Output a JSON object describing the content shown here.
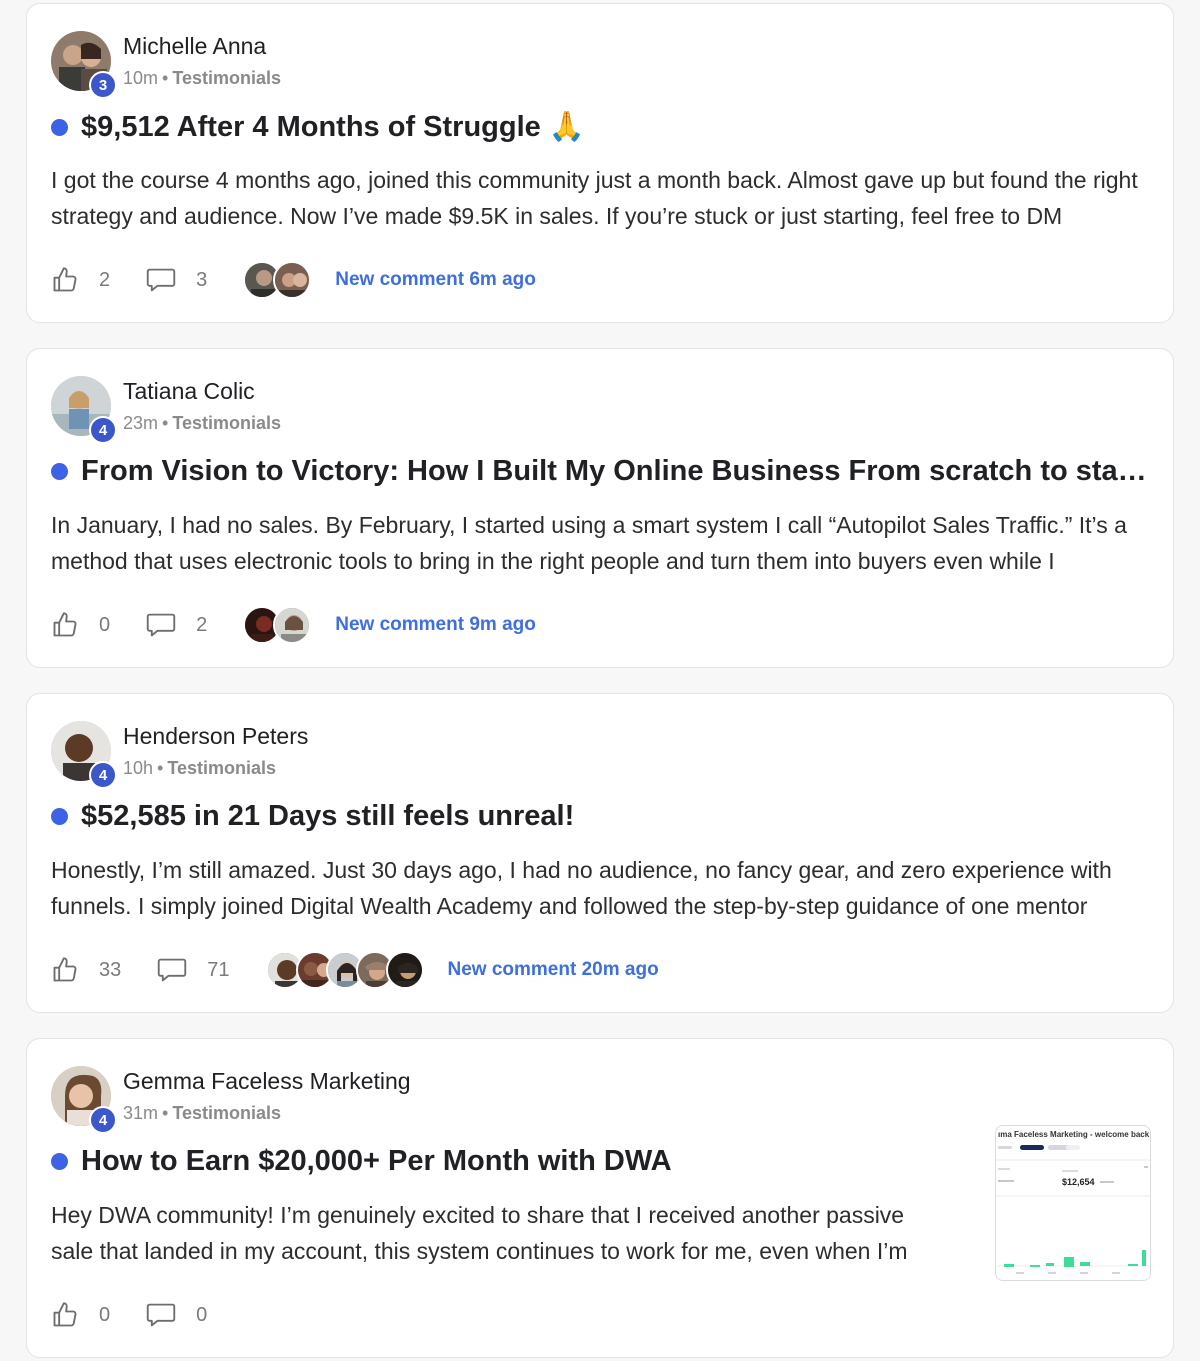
{
  "theme": {
    "accent": "#3e62e6",
    "link": "#3e6ee0",
    "badge": "#3c57c9",
    "chart_green": "#3ddc97"
  },
  "posts": [
    {
      "author": "Michelle Anna",
      "level": "3",
      "time": "10m",
      "category": "Testimonials",
      "title": "$9,512 After 4 Months of Struggle 🙏",
      "body": "I got the course 4 months ago, joined this community just a month back. Almost gave up but found the right strategy and audience. Now I’ve made $9.5K in sales. If you’re stuck or just starting, feel free to DM",
      "likes": "2",
      "comments": "3",
      "new_comment": "New comment 6m ago",
      "icons": {
        "like": "thumbs-up-icon",
        "comment": "speech-bubble-icon"
      }
    },
    {
      "author": "Tatiana Colic",
      "level": "4",
      "time": "23m",
      "category": "Testimonials",
      "title": "From Vision to Victory: How I Built My Online Business From scratch to stages...",
      "body": "In January, I had no sales. By February, I started using a smart system I call “Autopilot Sales Traffic.” It’s a method that uses electronic tools to bring in the right people and turn them into buyers even while I",
      "likes": "0",
      "comments": "2",
      "new_comment": "New comment 9m ago"
    },
    {
      "author": "Henderson Peters",
      "level": "4",
      "time": "10h",
      "category": "Testimonials",
      "title": "$52,585 in 21 Days still feels unreal!",
      "body": "Honestly, I’m still amazed. Just 30 days ago, I had no audience, no fancy gear, and zero experience with funnels. I simply joined Digital Wealth Academy and followed the step-by-step guidance of one mentor",
      "likes": "33",
      "comments": "71",
      "new_comment": "New comment 20m ago"
    },
    {
      "author": "Gemma Faceless Marketing",
      "level": "4",
      "time": "31m",
      "category": "Testimonials",
      "title": "How to Earn $20,000+ Per Month with DWA",
      "body": "Hey DWA community! I’m genuinely excited to share that I received another passive sale that landed in my account, this system continues to work for me, even when I’m",
      "likes": "0",
      "comments": "0",
      "thumbnail": {
        "heading": "ıma Faceless Marketing - welcome back",
        "amount": "$12,654"
      }
    }
  ]
}
